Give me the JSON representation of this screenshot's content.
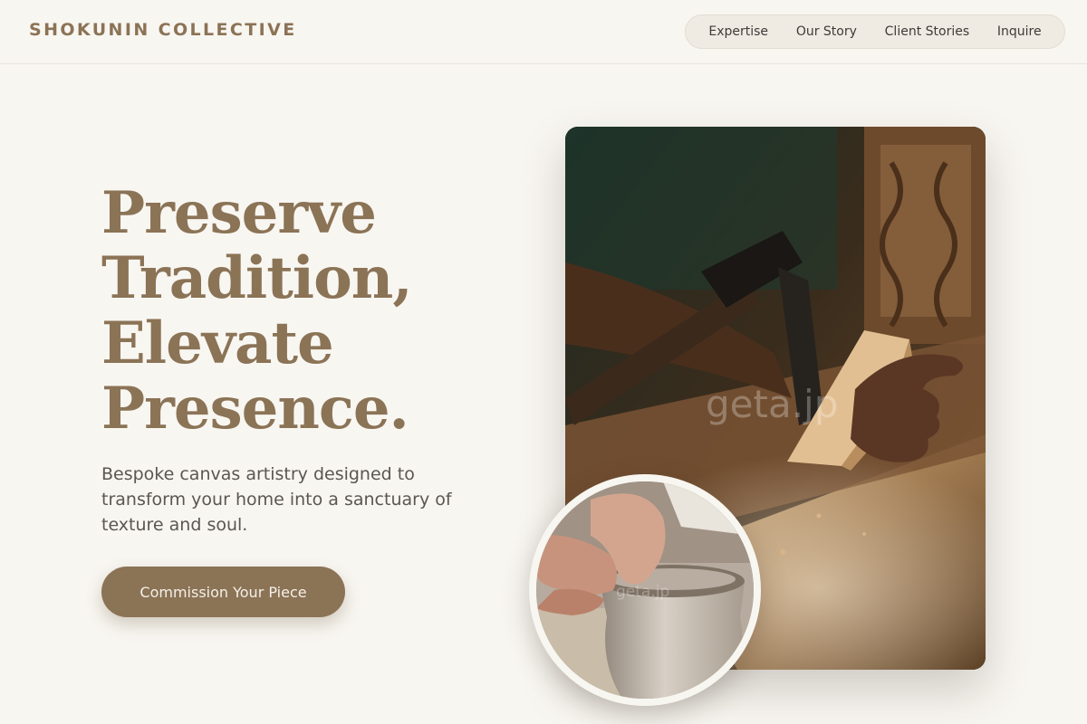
{
  "brand": {
    "name": "SHOKUNIN COLLECTIVE"
  },
  "nav": {
    "items": [
      {
        "label": "Expertise"
      },
      {
        "label": "Our Story"
      },
      {
        "label": "Client Stories"
      },
      {
        "label": "Inquire"
      }
    ]
  },
  "hero": {
    "headline_lines": [
      "Preserve",
      "Tradition,",
      "Elevate",
      "Presence."
    ],
    "subtext": "Bespoke canvas artistry designed to transform your home into a sanctuary of texture and soul.",
    "cta_label": "Commission Your Piece"
  },
  "images": {
    "main_watermark": "geta.jp",
    "inset_watermark": "geta.jp"
  },
  "colors": {
    "accent": "#8b7356",
    "background": "#f8f6f1",
    "nav_pill": "#efebe3"
  }
}
